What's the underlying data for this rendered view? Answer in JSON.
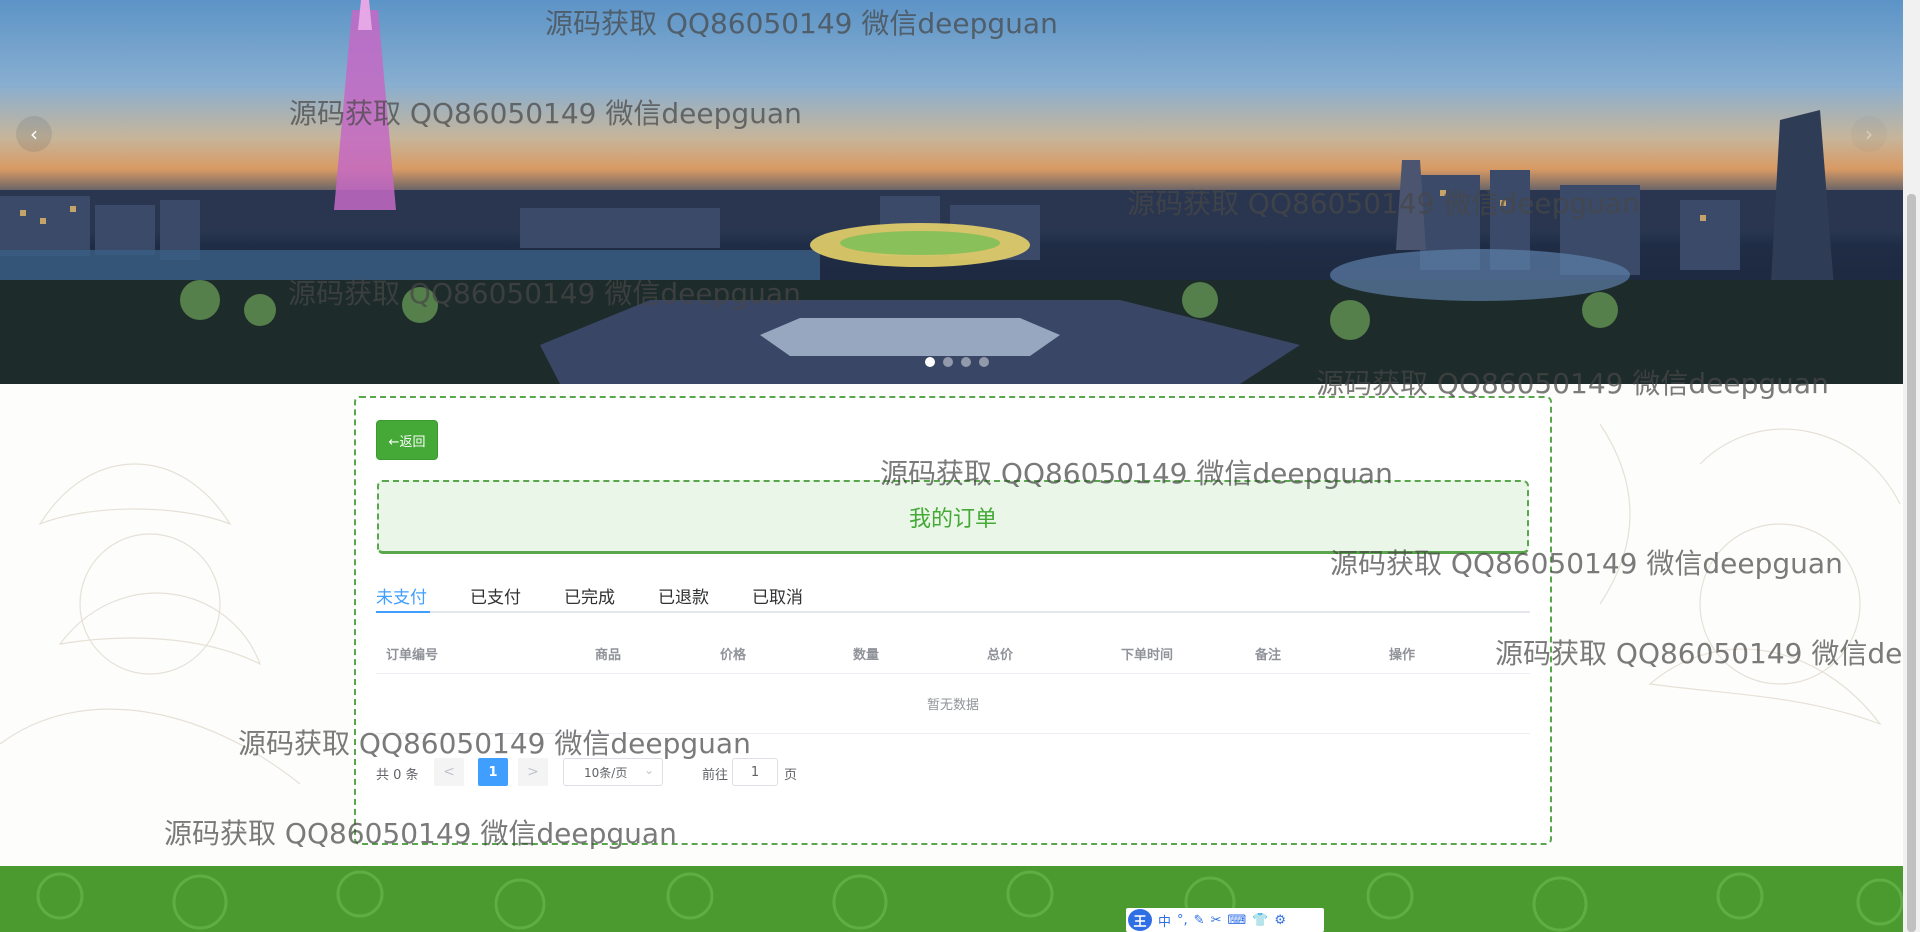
{
  "carousel": {
    "prev_icon": "‹",
    "next_icon": "›",
    "slide_count": 4,
    "active_slide": 1
  },
  "actions": {
    "back_label": "←返回"
  },
  "page": {
    "title": "我的订单"
  },
  "tabs": [
    "未支付",
    "已支付",
    "已完成",
    "已退款",
    "已取消"
  ],
  "active_tab": "未支付",
  "table": {
    "columns": [
      "订单编号",
      "商品",
      "价格",
      "数量",
      "总价",
      "下单时间",
      "备注",
      "操作"
    ],
    "empty_text": "暂无数据"
  },
  "pagination": {
    "total_text": "共 0 条",
    "prev": "<",
    "next": ">",
    "current_page": "1",
    "page_size": "10条/页",
    "goto_label": "前往",
    "goto_value": "1",
    "page_label": "页"
  },
  "ime_toolbar": {
    "logo": "王",
    "mode": "中",
    "icons": [
      "°,",
      "✎",
      "✂",
      "⌨",
      "👕",
      "⚙"
    ]
  },
  "watermark": "源码获取 QQ86050149 微信deepguan",
  "colors": {
    "primary_green": "#44a936",
    "active_blue": "#409eff",
    "footer_green": "#4b9a30"
  }
}
